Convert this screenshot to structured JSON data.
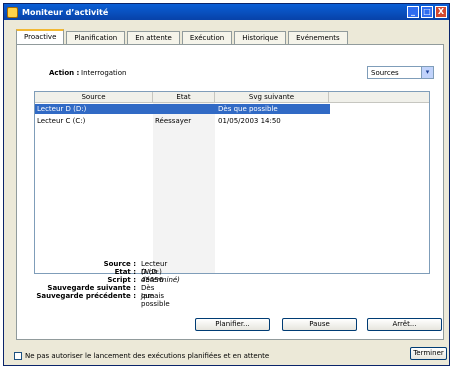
{
  "window": {
    "title": "Moniteur d’activité",
    "minimize": "_",
    "restore": "□",
    "close": "X"
  },
  "tabs": [
    "Proactive",
    "Planification",
    "En attente",
    "Exécution",
    "Historique",
    "Evénements"
  ],
  "action": {
    "label": "Action :",
    "value": "Interrogation"
  },
  "dropdown": {
    "selected": "Sources",
    "arrow": "▾"
  },
  "table": {
    "headers": [
      "Source",
      "Etat",
      "Svg suivante"
    ],
    "rows": [
      {
        "source": "Lecteur D (D:)",
        "etat": "",
        "suivante": "Dès que possible"
      },
      {
        "source": "Lecteur C (C:)",
        "etat": "Réessayer",
        "suivante": "01/05/2003 14:50"
      }
    ]
  },
  "details": [
    {
      "label": "Source :",
      "value": "Lecteur D (D:)"
    },
    {
      "label": "Etat :",
      "value": "(Non déterminé)"
    },
    {
      "label": "Script :",
      "value": "45456"
    },
    {
      "label": "Sauvegarde suivante :",
      "value": "Dès que possible"
    },
    {
      "label": "Sauvegarde précédente :",
      "value": "Jamais"
    }
  ],
  "buttons": {
    "schedule": "Planifier...",
    "pause": "Pause",
    "stop": "Arrêt...",
    "finish": "Terminer"
  },
  "checkbox": {
    "label": "Ne pas autoriser le lancement des exécutions planifiées et en attente"
  }
}
